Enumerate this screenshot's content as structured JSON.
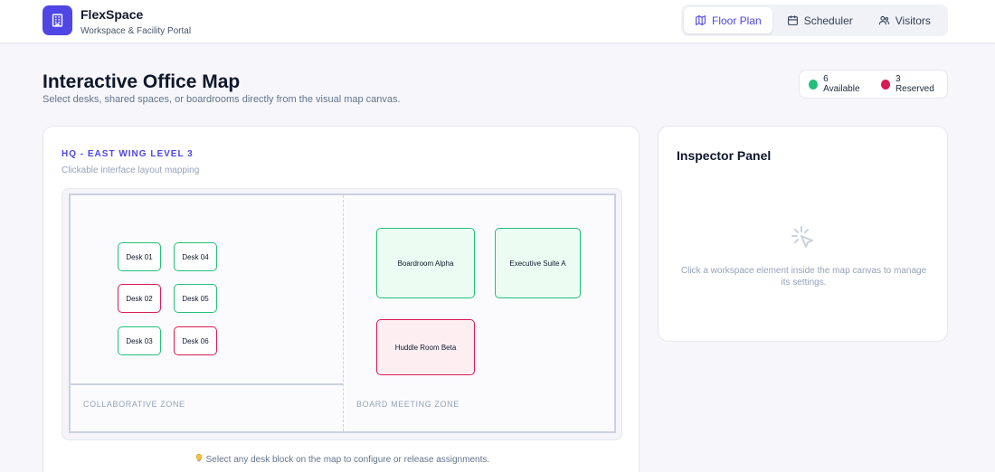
{
  "brand": {
    "name": "FlexSpace",
    "subtitle": "Workspace & Facility Portal"
  },
  "nav": {
    "items": [
      {
        "label": "Floor Plan",
        "icon": "map-icon",
        "active": true
      },
      {
        "label": "Scheduler",
        "icon": "calendar-icon",
        "active": false
      },
      {
        "label": "Visitors",
        "icon": "users-icon",
        "active": false
      }
    ]
  },
  "page": {
    "title": "Interactive Office Map",
    "subtitle": "Select desks, shared spaces, or boardrooms directly from the visual map canvas."
  },
  "legend": {
    "available": "6 Available",
    "reserved": "3 Reserved",
    "available_color": "#22c07a",
    "reserved_color": "#d81b55"
  },
  "map": {
    "eyebrow": "HQ - EAST WING LEVEL 3",
    "caption": "Clickable interface layout mapping",
    "zones": {
      "collab": "COLLABORATIVE ZONE",
      "board": "BOARD MEETING ZONE"
    },
    "desks": [
      {
        "label": "Desk 01",
        "status": "available"
      },
      {
        "label": "Desk 04",
        "status": "available"
      },
      {
        "label": "Desk 02",
        "status": "reserved"
      },
      {
        "label": "Desk 05",
        "status": "available"
      },
      {
        "label": "Desk 03",
        "status": "available"
      },
      {
        "label": "Desk 06",
        "status": "reserved"
      }
    ],
    "rooms": [
      {
        "label": "Boardroom Alpha",
        "status": "available"
      },
      {
        "label": "Executive Suite A",
        "status": "available"
      },
      {
        "label": "Huddle Room Beta",
        "status": "reserved"
      }
    ],
    "hint_icon": "lightbulb-icon",
    "hint": "Select any desk block on the map to configure or release assignments."
  },
  "inspector": {
    "title": "Inspector Panel",
    "empty_icon": "cursor-click-icon",
    "empty_text": "Click a workspace element inside the map canvas to manage its settings."
  }
}
